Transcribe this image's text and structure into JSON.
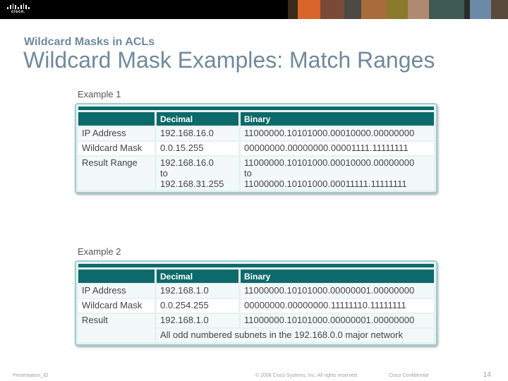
{
  "header": {
    "logo_text": "cisco.",
    "subtitle": "Wildcard Masks in ACLs",
    "title": "Wildcard Mask Examples: Match Ranges"
  },
  "example1": {
    "label": "Example 1",
    "columns": [
      "",
      "Decimal",
      "Binary"
    ],
    "rows": [
      {
        "label": "IP Address",
        "decimal": "192.168.16.0",
        "binary": "11000000.10101000.00010000.00000000"
      },
      {
        "label": "Wildcard Mask",
        "decimal": "0.0.15.255",
        "binary": "00000000.00000000.00001111.11111111"
      },
      {
        "label": "Result Range",
        "decimal_lines": [
          "192.168.16.0",
          "to",
          "192.168.31.255"
        ],
        "binary_lines": [
          "11000000.10101000.00010000.00000000",
          "to",
          "11000000.10101000.00011111.11111111"
        ]
      }
    ]
  },
  "example2": {
    "label": "Example 2",
    "columns": [
      "",
      "Decimal",
      "Binary"
    ],
    "rows": [
      {
        "label": "IP Address",
        "decimal": "192.168.1.0",
        "binary": "11000000.10101000.00000001.00000000"
      },
      {
        "label": "Wildcard Mask",
        "decimal": "0.0.254.255",
        "binary": "00000000.00000000.11111110.11111111"
      },
      {
        "label": "Result",
        "decimal": "192.168.1.0",
        "binary": "11000000.10101000.00000001.00000000"
      }
    ],
    "note": "All odd numbered subnets in the 192.168.0.0 major network"
  },
  "footer": {
    "presentation_id": "Presentation_ID",
    "copyright": "© 2008 Cisco Systems, Inc. All rights reserved.",
    "confidential": "Cisco Confidential",
    "page_number": "14"
  },
  "colors": {
    "title": "#6f8a9c",
    "table_header": "#0c6a6a",
    "table_border": "#9ccfcf"
  }
}
